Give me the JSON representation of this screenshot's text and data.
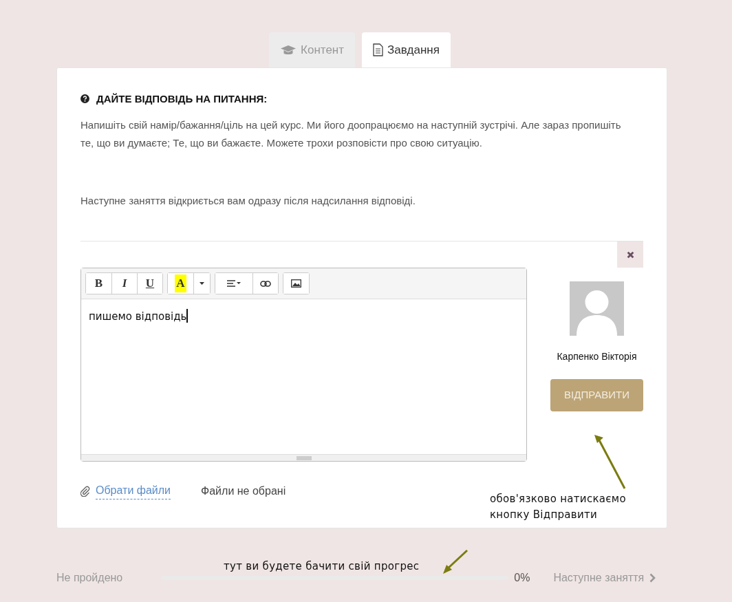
{
  "tabs": [
    {
      "label": "Контент",
      "kind": "content",
      "selected": false
    },
    {
      "label": "Завдання",
      "kind": "task",
      "selected": true
    }
  ],
  "question": {
    "title": "ДАЙТЕ ВІДПОВІДЬ НА ПИТАННЯ:",
    "paragraphs": [
      "Напишіть свій намір/бажання/ціль на цей курс. Ми його доопрацюємо на наступній зустрічі. Але зараз пропишіть те, що ви думаєте; Те, що ви бажаєте. Можете трохи розповісти про свою ситуацію.",
      "Наступне заняття відкриється вам одразу після надсилання відповіді."
    ]
  },
  "editor": {
    "toolbar": [
      [
        {
          "kind": "bold",
          "label": "B"
        },
        {
          "kind": "italic",
          "label": "I"
        },
        {
          "kind": "underline",
          "label": "U"
        }
      ],
      [
        {
          "kind": "color",
          "label": "A"
        },
        {
          "kind": "caret"
        }
      ],
      [
        {
          "kind": "align"
        },
        {
          "kind": "link"
        }
      ],
      [
        {
          "kind": "image"
        }
      ]
    ],
    "text": "пишемо відповідь"
  },
  "user": {
    "name": "Карпенко Вікторія"
  },
  "submit_button": "ВІДПРАВИТИ",
  "attachment": {
    "link": "Обрати файли",
    "status": "Файли не обрані"
  },
  "annotations": [
    {
      "kind": "submit",
      "text": "обов'язково натискаємо кнопку Відправити"
    },
    {
      "kind": "progress",
      "text": "тут ви будете бачити свій прогрес"
    }
  ],
  "progress": {
    "status": "Не пройдено",
    "level": 0,
    "reading": "0%",
    "next": "Наступне заняття"
  }
}
